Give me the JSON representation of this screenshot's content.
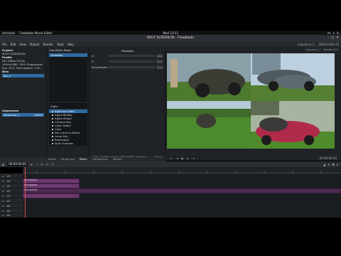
{
  "topbar": {
    "activities": "Activities",
    "app": "Flowblade Movie Editor",
    "clock": "Wed 13:53",
    "lang": "en"
  },
  "window": {
    "title": "SPLIT SCREEN.flb - Flowblade"
  },
  "menu": {
    "items": [
      "File",
      "Edit",
      "View",
      "Project",
      "Render",
      "Tools",
      "Help"
    ],
    "seq": "sequence_1",
    "fps": "1920x1080 25"
  },
  "project": {
    "header": "Project",
    "name": "SPLIT SCREEN.flb",
    "profile_label": "Profile",
    "profile": "HD 1080p 25 fps",
    "size": "1920x1080, 16:9, Progressive",
    "fps": "Fps: 25.0, Pixel Aspect: 1.00",
    "bins_label": "Bins",
    "bin": "bin_1",
    "sequences_label": "Sequences",
    "sequence": "sequence_1",
    "sequence_state": "active"
  },
  "stack": {
    "header": "Clip Filters Stack",
    "selected": "Translate"
  },
  "filters": {
    "category": "Alpha",
    "items": [
      "Alpha to Clean",
      "Alpha Modify",
      "Alpha Shape",
      "Chroma Key",
      "Color Select",
      "Crop",
      "File Luma to Alpha",
      "Luma Key",
      "Rotoshape",
      "Split Changes"
    ],
    "selected": 0
  },
  "params": {
    "title": "Translate",
    "rows": [
      {
        "label": "X:",
        "value": "480"
      },
      {
        "label": "Y:",
        "value": "540"
      },
      {
        "label": "Size/Height:",
        "value": "100"
      }
    ],
    "footer": [
      "Clip: 0.0000_mixer_0982/0980, pf.mmp, mkv",
      "Track: V1"
    ]
  },
  "monitor": {
    "header": [
      "sequence_1",
      "Monitor:0/1"
    ],
    "timecode": "00:00:00:00"
  },
  "tabs": {
    "items": [
      "Media",
      "Range Log",
      "Filters",
      "Compositors",
      "Render"
    ],
    "active": 2
  },
  "timeline": {
    "timecode": "00:00:00:00",
    "tracks": [
      "V5",
      "V4",
      "V3",
      "V2",
      "V1",
      "A1",
      "A2",
      "A3",
      "A4"
    ],
    "clip_labels": [
      "SPLIT BLOCK1",
      "SPLIT BLOCK2",
      "SPLIT BLOCK3"
    ]
  },
  "colors": {
    "accent": "#2e6ba3",
    "clip": "#6c3a70",
    "audio": "#274b5e",
    "playhead": "#e05050"
  }
}
